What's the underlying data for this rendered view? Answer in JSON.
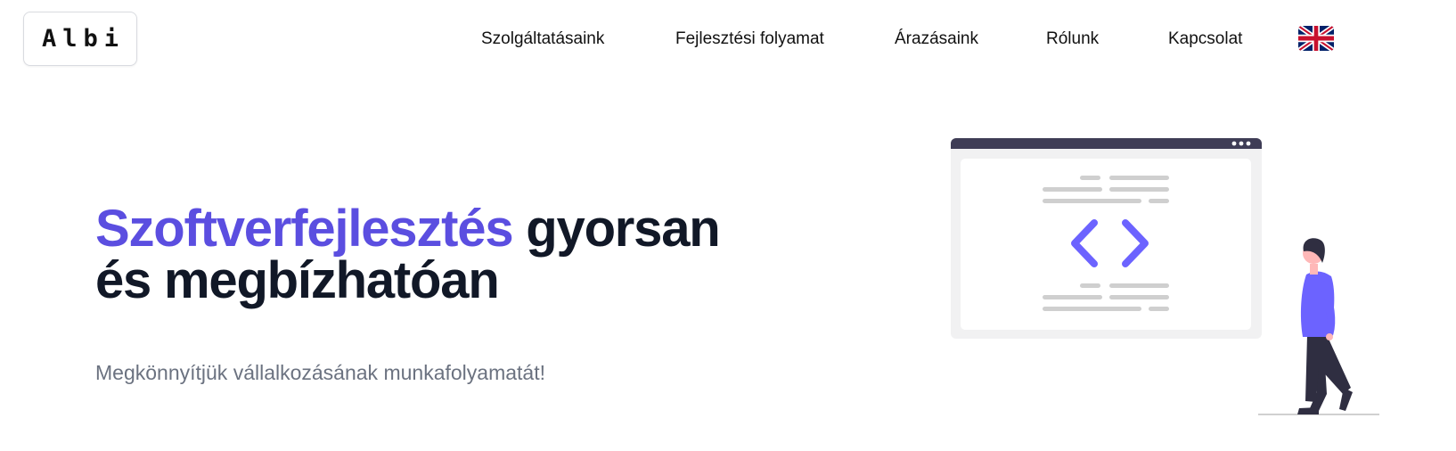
{
  "brand": {
    "logo_text": "Albi"
  },
  "nav": {
    "items": [
      {
        "label": "Szolgáltatásaink"
      },
      {
        "label": "Fejlesztési folyamat"
      },
      {
        "label": "Árazásaink"
      },
      {
        "label": "Rólunk"
      },
      {
        "label": "Kapcsolat"
      }
    ],
    "language_icon": "uk-flag-icon"
  },
  "hero": {
    "title_accent": "Szoftverfejlesztés",
    "title_rest_line1": "gyorsan",
    "title_line2": "és megbízhatóan",
    "subtitle": "Megkönnyítjük vállalkozásának munkafolyamatát!"
  },
  "colors": {
    "accent": "#5b4ee0",
    "illustration_accent": "#6c63ff",
    "title_text": "#111827",
    "subtitle_text": "#6b7280"
  }
}
